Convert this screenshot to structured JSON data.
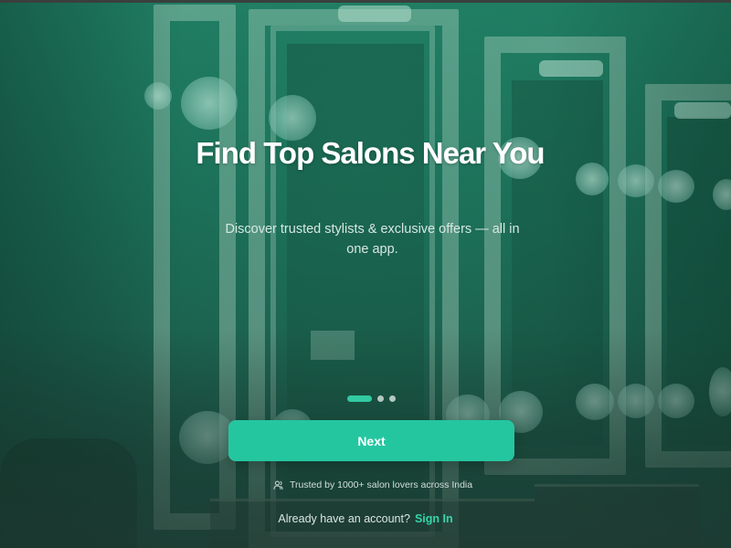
{
  "onboarding": {
    "headline": "Find Top Salons Near You",
    "subtitle": "Discover trusted stylists & exclusive offers — all in one app.",
    "pagination": {
      "total": 3,
      "current": 1
    },
    "next_label": "Next",
    "trust_text": "Trusted by 1000+ salon lovers across India",
    "account_prompt": "Already have an account?",
    "signin_label": "Sign In"
  },
  "icons": {
    "trust": "users-icon"
  },
  "colors": {
    "accent": "#24c6a0",
    "link": "#34d6ab",
    "background": "#1f7d62"
  }
}
